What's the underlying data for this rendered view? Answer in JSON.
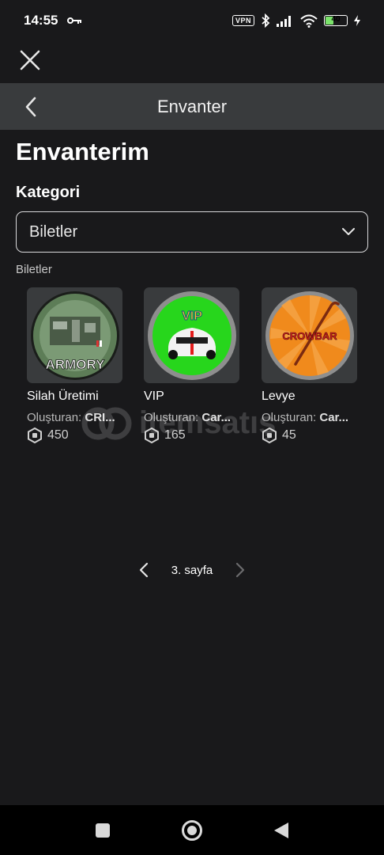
{
  "status": {
    "time": "14:55",
    "vpn": "VPN",
    "battery": "40"
  },
  "header": {
    "title": "Envanter"
  },
  "page": {
    "heading": "Envanterim",
    "category_label": "Kategori",
    "category_selected": "Biletler",
    "section_label": "Biletler"
  },
  "items": [
    {
      "name": "Silah Üretimi",
      "creator_prefix": "Oluşturan:",
      "creator": "CRI...",
      "price": "450",
      "thumb_text": "ARMORY"
    },
    {
      "name": "VIP",
      "creator_prefix": "Oluşturan:",
      "creator": "Car...",
      "price": "165",
      "thumb_text": "VIP"
    },
    {
      "name": "Levye",
      "creator_prefix": "Oluşturan:",
      "creator": "Car...",
      "price": "45",
      "thumb_text": "CROWBAR"
    }
  ],
  "pagination": {
    "label": "3. sayfa"
  },
  "watermark": "itemsatış",
  "colors": {
    "background": "#19191b",
    "header": "#393b3d",
    "card": "#393b3d"
  }
}
